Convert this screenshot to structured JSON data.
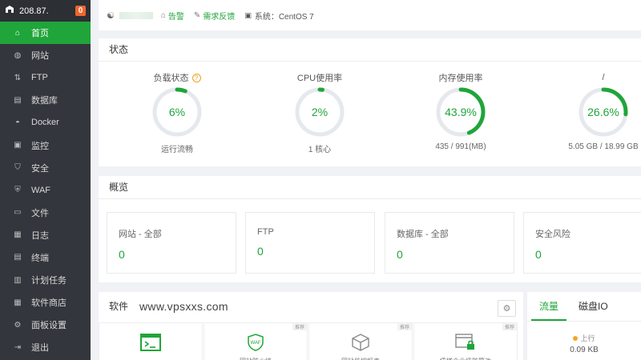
{
  "sidebar": {
    "ip": "208.87.",
    "badge": "0",
    "items": [
      {
        "label": "首页",
        "icon": "home-icon",
        "glyph": "⌂",
        "active": true
      },
      {
        "label": "网站",
        "icon": "globe-icon",
        "glyph": "◍"
      },
      {
        "label": "FTP",
        "icon": "ftp-icon",
        "glyph": "⇅"
      },
      {
        "label": "数据库",
        "icon": "database-icon",
        "glyph": "▤"
      },
      {
        "label": "Docker",
        "icon": "docker-icon",
        "glyph": "◓"
      },
      {
        "label": "监控",
        "icon": "monitor-icon",
        "glyph": "▣"
      },
      {
        "label": "安全",
        "icon": "shield-icon",
        "glyph": "⛉"
      },
      {
        "label": "WAF",
        "icon": "waf-icon",
        "glyph": "⛨"
      },
      {
        "label": "文件",
        "icon": "folder-icon",
        "glyph": "▭"
      },
      {
        "label": "日志",
        "icon": "log-icon",
        "glyph": "▦"
      },
      {
        "label": "终端",
        "icon": "terminal-icon",
        "glyph": "▤"
      },
      {
        "label": "计划任务",
        "icon": "schedule-icon",
        "glyph": "▥"
      },
      {
        "label": "软件商店",
        "icon": "store-icon",
        "glyph": "▦"
      },
      {
        "label": "面板设置",
        "icon": "gear-icon",
        "glyph": "⚙"
      },
      {
        "label": "退出",
        "icon": "logout-icon",
        "glyph": "⇥"
      }
    ]
  },
  "topbar": {
    "notice": "告警",
    "feedback": "需求反馈",
    "system": "系统：CentOS 7"
  },
  "status": {
    "title": "状态",
    "gauges": [
      {
        "title": "负载状态",
        "value": "6%",
        "percent": 6,
        "sub": "运行流畅",
        "help": true
      },
      {
        "title": "CPU使用率",
        "value": "2%",
        "percent": 2,
        "sub": "1 核心"
      },
      {
        "title": "内存使用率",
        "value": "43.9%",
        "percent": 43.9,
        "sub": "435 / 991(MB)"
      },
      {
        "title": "/",
        "value": "26.6%",
        "percent": 26.6,
        "sub": "5.05 GB / 18.99 GB"
      }
    ]
  },
  "overview": {
    "title": "概览",
    "boxes": [
      {
        "label": "网站 - 全部",
        "value": "0"
      },
      {
        "label": "FTP",
        "value": "0"
      },
      {
        "label": "数据库 - 全部",
        "value": "0"
      },
      {
        "label": "安全风险",
        "value": "0"
      }
    ]
  },
  "software": {
    "title": "软件",
    "watermark": "www.vpsxxs.com",
    "tiles": [
      {
        "icon": "terminal-app-icon",
        "tag": "",
        "name": ""
      },
      {
        "icon": "waf-app-icon",
        "tag": "推荐",
        "name": "网站防火墙"
      },
      {
        "icon": "box-app-icon",
        "tag": "推荐",
        "name": "网站监控报表"
      },
      {
        "icon": "lock-app-icon",
        "tag": "推荐",
        "name": "堡塔企业级防篡改"
      }
    ]
  },
  "traffic": {
    "tabs": [
      "流量",
      "磁盘IO"
    ],
    "up_label": "上行",
    "up_value": "0.09 KB"
  },
  "colors": {
    "accent": "#20a53a",
    "sidebar": "#33363c",
    "warn": "#f0a020"
  }
}
